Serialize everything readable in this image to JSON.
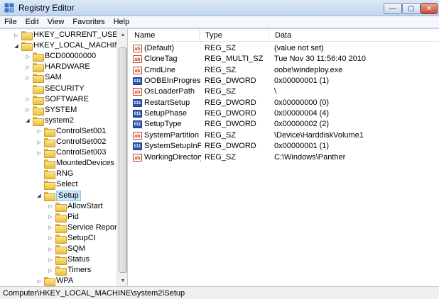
{
  "window": {
    "title": "Registry Editor",
    "minimize_glyph": "—",
    "maximize_glyph": "▢",
    "close_glyph": "✕"
  },
  "menu": [
    "File",
    "Edit",
    "View",
    "Favorites",
    "Help"
  ],
  "tree": [
    {
      "label": "HKEY_CURRENT_USER",
      "level": 1,
      "arrow": "collapsed"
    },
    {
      "label": "HKEY_LOCAL_MACHINE",
      "level": 1,
      "arrow": "expanded"
    },
    {
      "label": "BCD00000000",
      "level": 2,
      "arrow": "collapsed"
    },
    {
      "label": "HARDWARE",
      "level": 2,
      "arrow": "collapsed"
    },
    {
      "label": "SAM",
      "level": 2,
      "arrow": "collapsed"
    },
    {
      "label": "SECURITY",
      "level": 2,
      "arrow": "none"
    },
    {
      "label": "SOFTWARE",
      "level": 2,
      "arrow": "collapsed"
    },
    {
      "label": "SYSTEM",
      "level": 2,
      "arrow": "collapsed"
    },
    {
      "label": "system2",
      "level": 2,
      "arrow": "expanded"
    },
    {
      "label": "ControlSet001",
      "level": 3,
      "arrow": "collapsed"
    },
    {
      "label": "ControlSet002",
      "level": 3,
      "arrow": "collapsed"
    },
    {
      "label": "ControlSet003",
      "level": 3,
      "arrow": "collapsed"
    },
    {
      "label": "MountedDevices",
      "level": 3,
      "arrow": "none"
    },
    {
      "label": "RNG",
      "level": 3,
      "arrow": "none"
    },
    {
      "label": "Select",
      "level": 3,
      "arrow": "none"
    },
    {
      "label": "Setup",
      "level": 3,
      "arrow": "expanded",
      "selected": true
    },
    {
      "label": "AllowStart",
      "level": 4,
      "arrow": "collapsed"
    },
    {
      "label": "Pid",
      "level": 4,
      "arrow": "collapsed"
    },
    {
      "label": "Service Report",
      "level": 4,
      "arrow": "collapsed"
    },
    {
      "label": "SetupCI",
      "level": 4,
      "arrow": "collapsed"
    },
    {
      "label": "SQM",
      "level": 4,
      "arrow": "collapsed"
    },
    {
      "label": "Status",
      "level": 4,
      "arrow": "collapsed"
    },
    {
      "label": "Timers",
      "level": 4,
      "arrow": "collapsed"
    },
    {
      "label": "WPA",
      "level": 3,
      "arrow": "collapsed"
    }
  ],
  "values": {
    "columns": {
      "name": "Name",
      "type": "Type",
      "data": "Data"
    },
    "rows": [
      {
        "icon": "ab",
        "name": "(Default)",
        "type": "REG_SZ",
        "data": "(value not set)"
      },
      {
        "icon": "ab",
        "name": "CloneTag",
        "type": "REG_MULTI_SZ",
        "data": "Tue Nov 30 11:56:40 2010"
      },
      {
        "icon": "ab",
        "name": "CmdLine",
        "type": "REG_SZ",
        "data": "oobe\\windeploy.exe"
      },
      {
        "icon": "bin",
        "name": "OOBEInProgress",
        "type": "REG_DWORD",
        "data": "0x00000001 (1)"
      },
      {
        "icon": "ab",
        "name": "OsLoaderPath",
        "type": "REG_SZ",
        "data": "\\"
      },
      {
        "icon": "bin",
        "name": "RestartSetup",
        "type": "REG_DWORD",
        "data": "0x00000000 (0)"
      },
      {
        "icon": "bin",
        "name": "SetupPhase",
        "type": "REG_DWORD",
        "data": "0x00000004 (4)"
      },
      {
        "icon": "bin",
        "name": "SetupType",
        "type": "REG_DWORD",
        "data": "0x00000002 (2)"
      },
      {
        "icon": "ab",
        "name": "SystemPartition",
        "type": "REG_SZ",
        "data": "\\Device\\HarddiskVolume1"
      },
      {
        "icon": "bin",
        "name": "SystemSetupInP...",
        "type": "REG_DWORD",
        "data": "0x00000001 (1)"
      },
      {
        "icon": "ab",
        "name": "WorkingDirectory",
        "type": "REG_SZ",
        "data": "C:\\Windows\\Panther"
      }
    ]
  },
  "icon_text": {
    "ab": "ab",
    "bin": "011"
  },
  "statusbar": {
    "path": "Computer\\HKEY_LOCAL_MACHINE\\system2\\Setup"
  },
  "colors": {
    "selection": "#cbe6ff",
    "close_button": "#c74a31"
  }
}
